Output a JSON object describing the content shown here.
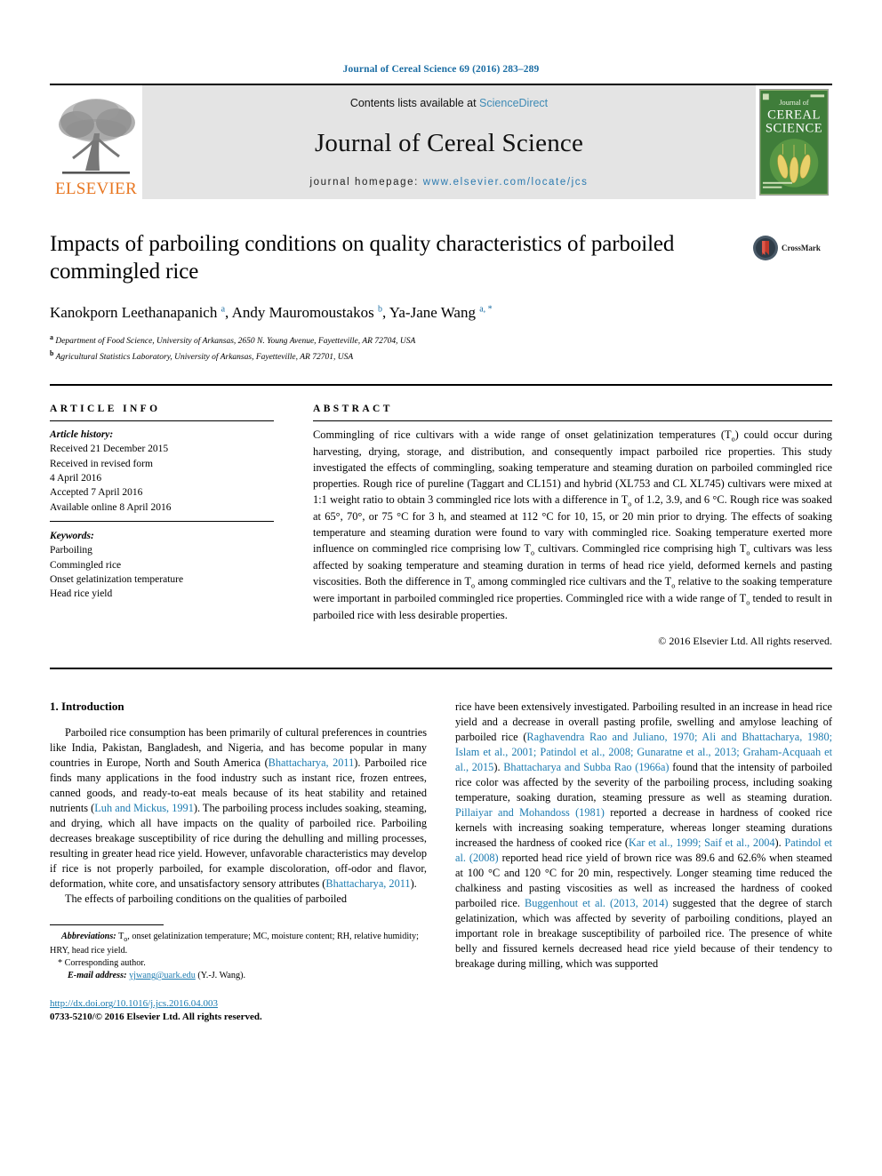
{
  "running_head": "Journal of Cereal Science 69 (2016) 283–289",
  "masthead": {
    "contents_prefix": "Contents lists available at ",
    "sciencedirect": "ScienceDirect",
    "journal_name": "Journal of Cereal Science",
    "homepage_prefix": "journal homepage: ",
    "homepage_url": "www.elsevier.com/locate/jcs",
    "publisher": "ELSEVIER",
    "cover": {
      "line1": "Journal of",
      "line2": "CEREAL",
      "line3": "SCIENCE"
    },
    "colors": {
      "band_bg": "#e4e4e4",
      "link": "#3d8ab5",
      "elsevier_orange": "#e87722",
      "cover_green": "#3f7d3a"
    }
  },
  "article": {
    "title": "Impacts of parboiling conditions on quality characteristics of parboiled commingled rice",
    "crossmark_label": "CrossMark",
    "authors_html": "Kanokporn Leethanapanich <sup>a</sup>, Andy Mauromoustakos <sup>b</sup>, Ya-Jane Wang <sup>a, *</sup>",
    "affiliation_a": "Department of Food Science, University of Arkansas, 2650 N. Young Avenue, Fayetteville, AR 72704, USA",
    "affiliation_b": "Agricultural Statistics Laboratory, University of Arkansas, Fayetteville, AR 72701, USA"
  },
  "article_info": {
    "label": "ARTICLE INFO",
    "history_heading": "Article history:",
    "history": [
      "Received 21 December 2015",
      "Received in revised form",
      "4 April 2016",
      "Accepted 7 April 2016",
      "Available online 8 April 2016"
    ],
    "keywords_heading": "Keywords:",
    "keywords": [
      "Parboiling",
      "Commingled rice",
      "Onset gelatinization temperature",
      "Head rice yield"
    ]
  },
  "abstract": {
    "label": "ABSTRACT",
    "text": "Commingling of rice cultivars with a wide range of onset gelatinization temperatures (To) could occur during harvesting, drying, storage, and distribution, and consequently impact parboiled rice properties. This study investigated the effects of commingling, soaking temperature and steaming duration on parboiled commingled rice properties. Rough rice of pureline (Taggart and CL151) and hybrid (XL753 and CL XL745) cultivars were mixed at 1:1 weight ratio to obtain 3 commingled rice lots with a difference in To of 1.2, 3.9, and 6 °C. Rough rice was soaked at 65°, 70°, or 75 °C for 3 h, and steamed at 112 °C for 10, 15, or 20 min prior to drying. The effects of soaking temperature and steaming duration were found to vary with commingled rice. Soaking temperature exerted more influence on commingled rice comprising low To cultivars. Commingled rice comprising high To cultivars was less affected by soaking temperature and steaming duration in terms of head rice yield, deformed kernels and pasting viscosities. Both the difference in To among commingled rice cultivars and the To relative to the soaking temperature were important in parboiled commingled rice properties. Commingled rice with a wide range of To tended to result in parboiled rice with less desirable properties.",
    "copyright": "© 2016 Elsevier Ltd. All rights reserved."
  },
  "introduction": {
    "heading": "1. Introduction",
    "left_paragraph_1": "Parboiled rice consumption has been primarily of cultural preferences in countries like India, Pakistan, Bangladesh, and Nigeria, and has become popular in many countries in Europe, North and South America (Bhattacharya, 2011). Parboiled rice finds many applications in the food industry such as instant rice, frozen entrees, canned goods, and ready-to-eat meals because of its heat stability and retained nutrients (Luh and Mickus, 1991). The parboiling process includes soaking, steaming, and drying, which all have impacts on the quality of parboiled rice. Parboiling decreases breakage susceptibility of rice during the dehulling and milling processes, resulting in greater head rice yield. However, unfavorable characteristics may develop if rice is not properly parboiled, for example discoloration, off-odor and flavor, deformation, white core, and unsatisfactory sensory attributes (Bhattacharya, 2011).",
    "left_paragraph_2": "The effects of parboiling conditions on the qualities of parboiled",
    "right_paragraph": "rice have been extensively investigated. Parboiling resulted in an increase in head rice yield and a decrease in overall pasting profile, swelling and amylose leaching of parboiled rice (Raghavendra Rao and Juliano, 1970; Ali and Bhattacharya, 1980; Islam et al., 2001; Patindol et al., 2008; Gunaratne et al., 2013; Graham-Acquaah et al., 2015). Bhattacharya and Subba Rao (1966a) found that the intensity of parboiled rice color was affected by the severity of the parboiling process, including soaking temperature, soaking duration, steaming pressure as well as steaming duration. Pillaiyar and Mohandoss (1981) reported a decrease in hardness of cooked rice kernels with increasing soaking temperature, whereas longer steaming durations increased the hardness of cooked rice (Kar et al., 1999; Saif et al., 2004). Patindol et al. (2008) reported head rice yield of brown rice was 89.6 and 62.6% when steamed at 100 °C and 120 °C for 20 min, respectively. Longer steaming time reduced the chalkiness and pasting viscosities as well as increased the hardness of cooked parboiled rice. Buggenhout et al. (2013, 2014) suggested that the degree of starch gelatinization, which was affected by severity of parboiling conditions, played an important role in breakage susceptibility of parboiled rice. The presence of white belly and fissured kernels decreased head rice yield because of their tendency to breakage during milling, which was supported"
  },
  "footnotes": {
    "abbreviations_heading": "Abbreviations:",
    "abbreviations_text": " To, onset gelatinization temperature; MC, moisture content; RH, relative humidity; HRY, head rice yield.",
    "corresponding": "Corresponding author.",
    "email_label": "E-mail address:",
    "email": "yjwang@uark.edu",
    "email_suffix": " (Y.-J. Wang).",
    "doi": "http://dx.doi.org/10.1016/j.jcs.2016.04.003",
    "issn_line": "0733-5210/© 2016 Elsevier Ltd. All rights reserved."
  }
}
